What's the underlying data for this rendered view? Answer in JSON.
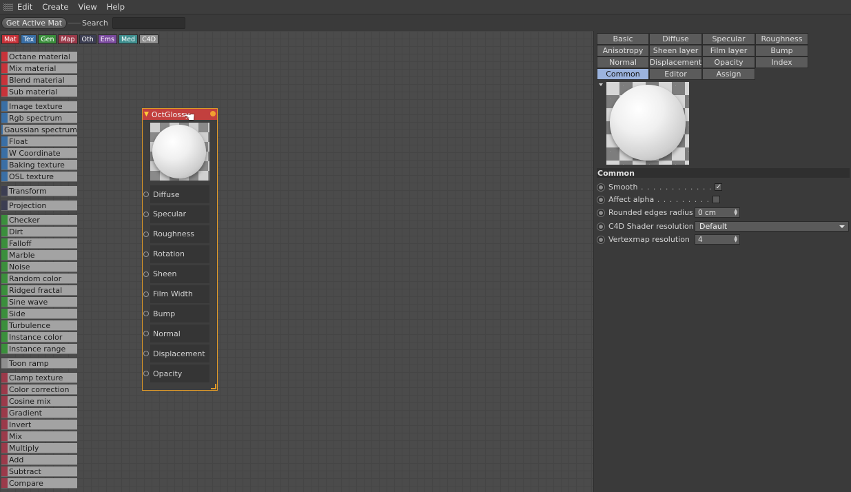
{
  "menubar": {
    "items": [
      "Edit",
      "Create",
      "View",
      "Help"
    ]
  },
  "toolbar": {
    "get_active_mat": "Get Active Mat",
    "search_label": "Search",
    "search_value": ""
  },
  "categories": [
    {
      "label": "Mat",
      "color": "#c8333a"
    },
    {
      "label": "Tex",
      "color": "#3a6fa5"
    },
    {
      "label": "Gen",
      "color": "#3b8f3c"
    },
    {
      "label": "Map",
      "color": "#9b3a4a"
    },
    {
      "label": "Oth",
      "color": "#3c3e52"
    },
    {
      "label": "Ems",
      "color": "#7a4a9e"
    },
    {
      "label": "Med",
      "color": "#3f8f8f"
    },
    {
      "label": "C4D",
      "color": "#8f8f8f"
    }
  ],
  "node_list": [
    {
      "label": "Octane material",
      "color": "#c8333a"
    },
    {
      "label": "Mix material",
      "color": "#c8333a"
    },
    {
      "label": "Blend material",
      "color": "#c8333a"
    },
    {
      "label": "Sub material",
      "color": "#c8333a"
    },
    {
      "label": "Image texture",
      "color": "#3a6fa5"
    },
    {
      "label": "Rgb spectrum",
      "color": "#3a6fa5"
    },
    {
      "label": "Gaussian spectrum",
      "color": "#3a6fa5"
    },
    {
      "label": "Float",
      "color": "#3a6fa5"
    },
    {
      "label": "W Coordinate",
      "color": "#3a6fa5"
    },
    {
      "label": "Baking texture",
      "color": "#3a6fa5"
    },
    {
      "label": "OSL texture",
      "color": "#3a6fa5"
    },
    {
      "label": "Transform",
      "color": "#3c3e52"
    },
    {
      "label": "Projection",
      "color": "#3c3e52"
    },
    {
      "label": "Checker",
      "color": "#3b8f3c"
    },
    {
      "label": "Dirt",
      "color": "#3b8f3c"
    },
    {
      "label": "Falloff",
      "color": "#3b8f3c"
    },
    {
      "label": "Marble",
      "color": "#3b8f3c"
    },
    {
      "label": "Noise",
      "color": "#3b8f3c"
    },
    {
      "label": "Random color",
      "color": "#3b8f3c"
    },
    {
      "label": "Ridged fractal",
      "color": "#3b8f3c"
    },
    {
      "label": "Sine wave",
      "color": "#3b8f3c"
    },
    {
      "label": "Side",
      "color": "#3b8f3c"
    },
    {
      "label": "Turbulence",
      "color": "#3b8f3c"
    },
    {
      "label": "Instance color",
      "color": "#3b8f3c"
    },
    {
      "label": "Instance range",
      "color": "#3b8f3c"
    },
    {
      "label": "Toon ramp",
      "color": "#8f8f8f"
    },
    {
      "label": "Clamp texture",
      "color": "#9b3a4a"
    },
    {
      "label": "Color correction",
      "color": "#9b3a4a"
    },
    {
      "label": "Cosine mix",
      "color": "#9b3a4a"
    },
    {
      "label": "Gradient",
      "color": "#9b3a4a"
    },
    {
      "label": "Invert",
      "color": "#9b3a4a"
    },
    {
      "label": "Mix",
      "color": "#9b3a4a"
    },
    {
      "label": "Multiply",
      "color": "#9b3a4a"
    },
    {
      "label": "Add",
      "color": "#9b3a4a"
    },
    {
      "label": "Subtract",
      "color": "#9b3a4a"
    },
    {
      "label": "Compare",
      "color": "#9b3a4a"
    }
  ],
  "graph_node": {
    "title": "OctGlossy",
    "ports": [
      "Diffuse",
      "Specular",
      "Roughness",
      "Rotation",
      "Sheen",
      "Film Width",
      "Bump",
      "Normal",
      "Displacement",
      "Opacity"
    ]
  },
  "tabs": [
    {
      "label": "Basic",
      "active": false
    },
    {
      "label": "Diffuse",
      "active": false
    },
    {
      "label": "Specular",
      "active": false
    },
    {
      "label": "Roughness",
      "active": false
    },
    {
      "label": "Anisotropy",
      "active": false
    },
    {
      "label": "Sheen layer",
      "active": false
    },
    {
      "label": "Film layer",
      "active": false
    },
    {
      "label": "Bump",
      "active": false
    },
    {
      "label": "Normal",
      "active": false
    },
    {
      "label": "Displacement",
      "active": false
    },
    {
      "label": "Opacity",
      "active": false
    },
    {
      "label": "Index",
      "active": false
    },
    {
      "label": "Common",
      "active": true
    },
    {
      "label": "Editor",
      "active": false
    },
    {
      "label": "Assign",
      "active": false
    }
  ],
  "common": {
    "title": "Common",
    "smooth_label": "Smooth",
    "smooth_dots": " . . . . . . . . . . . .",
    "smooth_checked": true,
    "smooth_mark": "✓",
    "affect_alpha_label": "Affect alpha",
    "affect_alpha_dots": " . . . . . . . . .",
    "affect_alpha_checked": false,
    "rounded_edges_label": "Rounded edges radius",
    "rounded_edges_value": "0 cm",
    "c4d_shader_label": "C4D Shader resolution",
    "c4d_shader_value": "Default",
    "vertexmap_label": "Vertexmap resolution",
    "vertexmap_value": "4"
  }
}
